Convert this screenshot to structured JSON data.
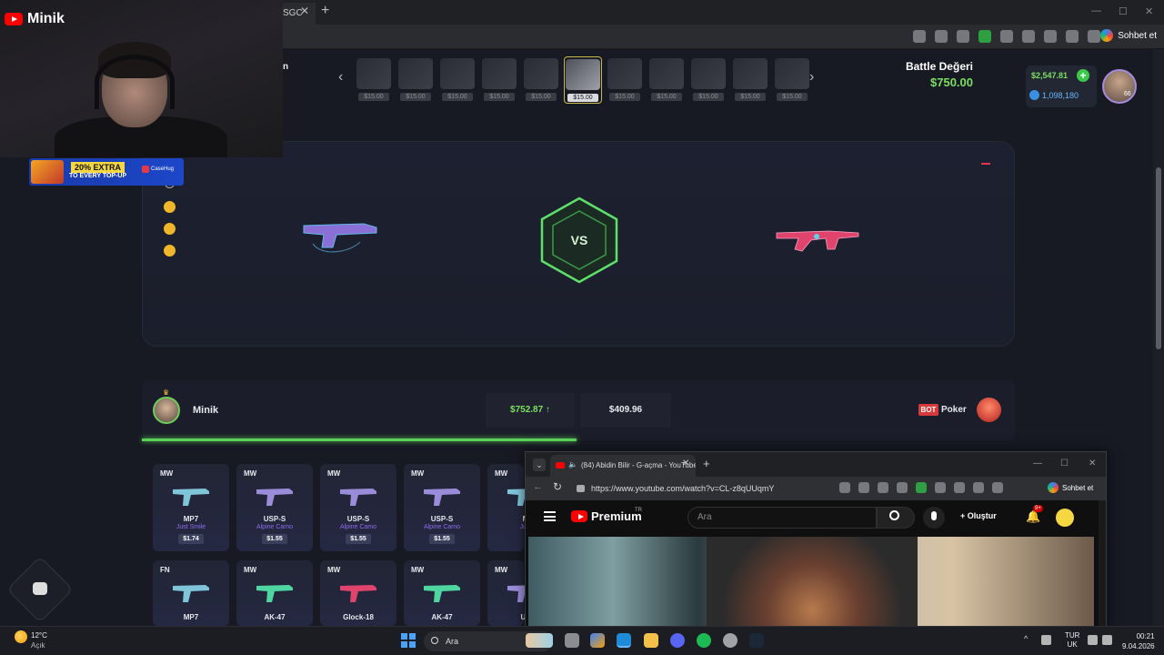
{
  "browser": {
    "tab_fragment": "SGC",
    "sohbet_label": "Sohbet et"
  },
  "webcam": {
    "channel_name": "Minik",
    "promo": {
      "extra": "20% EXTRA",
      "sub": "TO EVERY TOP-UP",
      "brand": "CaseHug"
    }
  },
  "site": {
    "nav_fragment": "n",
    "case_price": "$15.00",
    "case_count": 11,
    "active_case_index": 5,
    "battle_value_label": "Battle Değeri",
    "battle_value": "$750.00",
    "balance": "$2,547.81",
    "coins": "1,098,180",
    "level": "66",
    "vs_label": "VS",
    "player1": {
      "name": "Minik",
      "total": "$752.87 ↑"
    },
    "player2": {
      "badge": "BOT",
      "name": "Poker",
      "total": "$409.96"
    },
    "items_row1": [
      {
        "cond": "MW",
        "name": "MP7",
        "skin": "Just Smile",
        "price": "$1.74",
        "gun": "#7fc4d9"
      },
      {
        "cond": "MW",
        "name": "USP-S",
        "skin": "Alpine Camo",
        "price": "$1.55",
        "gun": "#9a8cd9"
      },
      {
        "cond": "MW",
        "name": "USP-S",
        "skin": "Alpine Camo",
        "price": "$1.55",
        "gun": "#9a8cd9"
      },
      {
        "cond": "MW",
        "name": "USP-S",
        "skin": "Alpine Camo",
        "price": "$1.55",
        "gun": "#9a8cd9"
      },
      {
        "cond": "MW",
        "name": "M",
        "skin": "Just",
        "price": "",
        "gun": "#7fc4d9"
      }
    ],
    "items_row2": [
      {
        "cond": "FN",
        "name": "MP7",
        "gun": "#7fc4d9"
      },
      {
        "cond": "MW",
        "name": "AK-47",
        "gun": "#4fd6a0"
      },
      {
        "cond": "MW",
        "name": "Glock-18",
        "gun": "#e0436b"
      },
      {
        "cond": "MW",
        "name": "AK-47",
        "gun": "#4fd6a0"
      },
      {
        "cond": "MW",
        "name": "US",
        "gun": "#9a8cd9"
      }
    ]
  },
  "mini_browser": {
    "tab_title": "(84) Abidin Bilir - G-açma - YouTube",
    "url": "https://www.youtube.com/watch?v=CL-z8qUUqmY",
    "sohbet_label": "Sohbet et",
    "yt_brand": "Premium",
    "yt_region": "TR",
    "search_placeholder": "Ara",
    "create_label": "Oluştur",
    "notif_badge": "9+"
  },
  "taskbar": {
    "temp": "12°C",
    "condition": "Açık",
    "search_placeholder": "Ara",
    "lang_top": "TUR",
    "lang_bottom": "UK",
    "time": "00:21",
    "date": "9.04.2026"
  },
  "colors": {
    "accent_green": "#7be05f",
    "bot_red": "#d73a3a",
    "skin_purple": "#8e6bef"
  }
}
